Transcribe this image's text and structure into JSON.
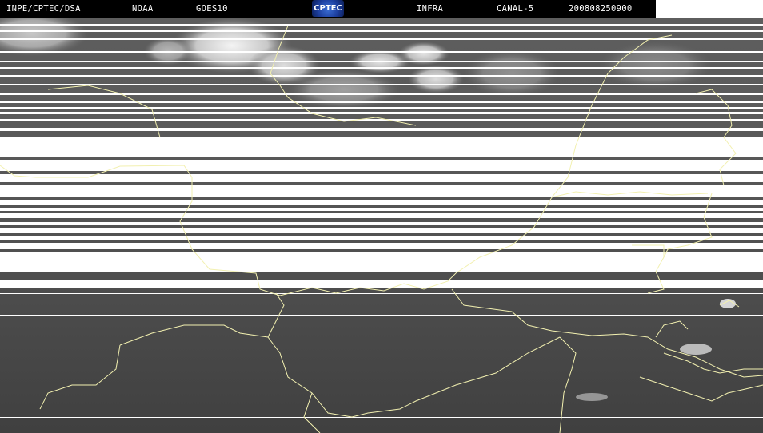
{
  "header": {
    "org": "INPE/CPTEC/DSA",
    "agency": "NOAA",
    "satellite": "GOES10",
    "logo_text": "CPTEC",
    "product": "INFRA",
    "channel": "CANAL-5",
    "timestamp": "200808250900"
  },
  "colors": {
    "header_background": "#000000",
    "header_text": "#ffffff",
    "coastline": "#f2f0b0",
    "logo_blue": "#1c3e9e"
  }
}
